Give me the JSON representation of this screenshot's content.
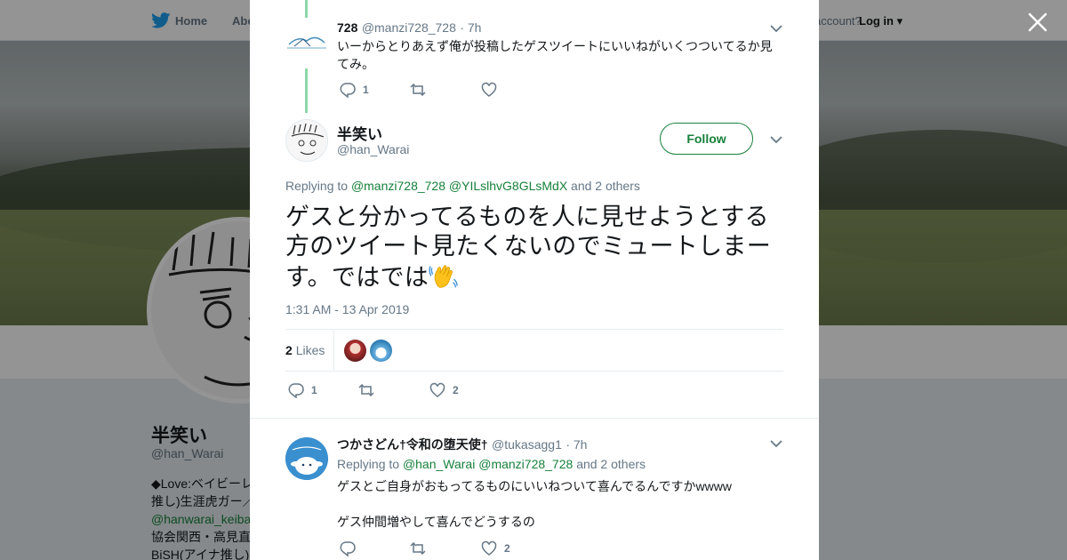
{
  "topbar": {
    "home": "Home",
    "about": "Abo",
    "account_q": "account?",
    "login": "Log in"
  },
  "profile": {
    "name": "半笑い",
    "handle": "@han_Warai",
    "bio_lines": [
      "◆Love:ベイビーレ",
      "推し)生涯虎ガー／",
      "@hanwarai_keiba",
      "協会関西・高見直",
      "BiSH(アイナ推し)"
    ]
  },
  "thread": {
    "prev": {
      "name": "728",
      "handle": "@manzi728_728",
      "time": "· 7h",
      "text": "いーからとりあえず俺が投稿したゲスツイートにいいねがいくつついてるか見てみ。",
      "reply_count": "1"
    },
    "main": {
      "name": "半笑い",
      "handle": "@han_Warai",
      "follow_label": "Follow",
      "replying_prefix": "Replying to",
      "replying_1": "@manzi728_728",
      "replying_2": "@YILslhvG8GLsMdX",
      "replying_suffix": "and 2 others",
      "text": "ゲスと分かってるものを人に見せようとする方のツイート見たくないのでミュートしまーす。ではでは",
      "timestamp": "1:31 AM - 13 Apr 2019",
      "likes_count": "2",
      "likes_label": "Likes",
      "reply_count": "1",
      "like_count": "2"
    },
    "reply": {
      "name": "つかさどん†令和の堕天使†",
      "handle": "@tukasagg1",
      "time": "· 7h",
      "replying_prefix": "Replying to",
      "replying_1": "@han_Warai",
      "replying_2": "@manzi728_728",
      "replying_suffix": "and 2 others",
      "text_1": "ゲスとご自身がおもってるものにいいねついて喜んでるんですかwwww",
      "text_2": "ゲス仲間増やして喜んでどうするの",
      "like_count": "2"
    }
  },
  "colors": {
    "link": "#17803b",
    "thread_line": "#8dd7a9",
    "muted": "#657786"
  }
}
